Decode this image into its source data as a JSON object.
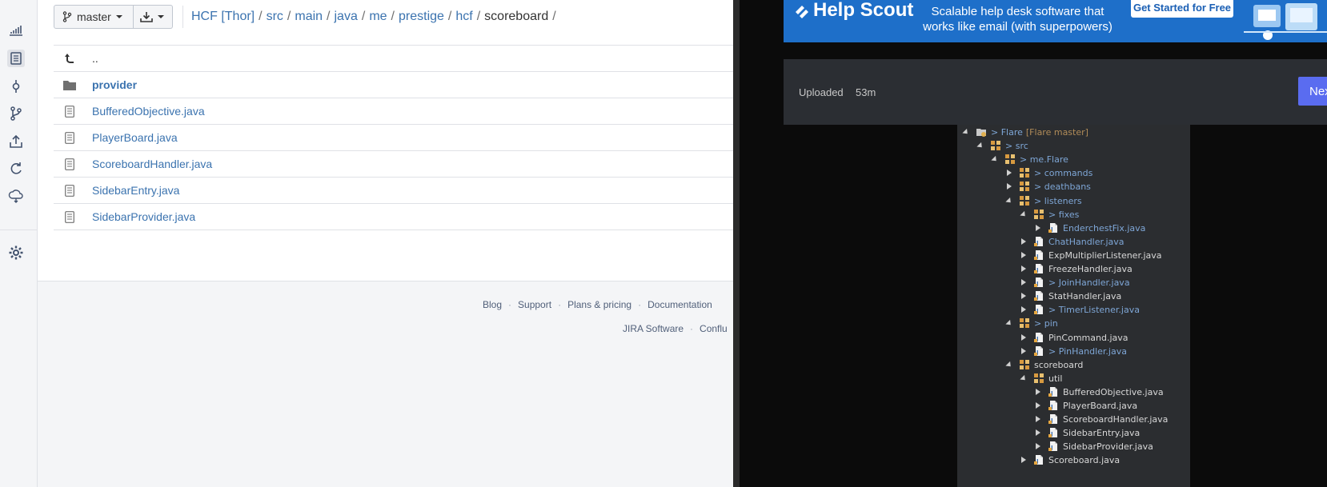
{
  "toolbar": {
    "branch_label": "master"
  },
  "breadcrumb": {
    "items": [
      "HCF [Thor]",
      "src",
      "main",
      "java",
      "me",
      "prestige",
      "hcf"
    ],
    "current": "scoreboard",
    "separator": "/"
  },
  "files": {
    "up": "..",
    "folder": "provider",
    "items": [
      "BufferedObjective.java",
      "PlayerBoard.java",
      "ScoreboardHandler.java",
      "SidebarEntry.java",
      "SidebarProvider.java"
    ]
  },
  "footer": {
    "row1": [
      "Blog",
      "Support",
      "Plans & pricing",
      "Documentation"
    ],
    "row2": [
      "JIRA Software",
      "Conflu"
    ]
  },
  "ad": {
    "brand": "Help Scout",
    "text_line1": "Scalable help desk software that",
    "text_line2": "works like email (with superpowers)",
    "cta": "Get Started for Free"
  },
  "post": {
    "uploaded_label": "Uploaded",
    "time": "53m",
    "next_label": "Next Post"
  },
  "tree": {
    "project_prefix": "> Flare",
    "project_annotation": "[Flare master]",
    "nodes": [
      {
        "label": "> src",
        "color": "blue",
        "twisty": "open",
        "icon": "src-folder-icon"
      },
      {
        "label": "> me.Flare",
        "color": "blue",
        "twisty": "open",
        "icon": "package-icon"
      },
      {
        "label": "> commands",
        "color": "blue",
        "twisty": "closed",
        "icon": "package-icon"
      },
      {
        "label": "> deathbans",
        "color": "blue",
        "twisty": "closed",
        "icon": "package-icon"
      },
      {
        "label": "> listeners",
        "color": "blue",
        "twisty": "open",
        "icon": "package-icon"
      },
      {
        "label": "> fixes",
        "color": "blue",
        "twisty": "open",
        "icon": "package-icon"
      },
      {
        "label": "EnderchestFix.java",
        "color": "blue",
        "twisty": "closed",
        "icon": "java-file-icon"
      },
      {
        "label": "ChatHandler.java",
        "color": "blue",
        "twisty": "closed",
        "icon": "java-file-icon"
      },
      {
        "label": "ExpMultiplierListener.java",
        "color": "white",
        "twisty": "closed",
        "icon": "java-file-icon"
      },
      {
        "label": "FreezeHandler.java",
        "color": "white",
        "twisty": "closed",
        "icon": "java-file-icon"
      },
      {
        "label": "> JoinHandler.java",
        "color": "blue",
        "twisty": "closed",
        "icon": "java-file-icon"
      },
      {
        "label": "StatHandler.java",
        "color": "white",
        "twisty": "closed",
        "icon": "java-file-icon"
      },
      {
        "label": "> TimerListener.java",
        "color": "blue",
        "twisty": "closed",
        "icon": "java-file-icon"
      },
      {
        "label": "> pin",
        "color": "blue",
        "twisty": "open",
        "icon": "package-icon"
      },
      {
        "label": "PinCommand.java",
        "color": "white",
        "twisty": "closed",
        "icon": "java-file-icon"
      },
      {
        "label": "> PinHandler.java",
        "color": "blue",
        "twisty": "closed",
        "icon": "java-file-icon"
      },
      {
        "label": "scoreboard",
        "color": "white",
        "twisty": "open",
        "icon": "package-icon"
      },
      {
        "label": "util",
        "color": "white",
        "twisty": "open",
        "icon": "package-icon"
      },
      {
        "label": "BufferedObjective.java",
        "color": "white",
        "twisty": "closed",
        "icon": "java-file-icon"
      },
      {
        "label": "PlayerBoard.java",
        "color": "white",
        "twisty": "closed",
        "icon": "java-file-icon"
      },
      {
        "label": "ScoreboardHandler.java",
        "color": "white",
        "twisty": "closed",
        "icon": "java-file-icon"
      },
      {
        "label": "SidebarEntry.java",
        "color": "white",
        "twisty": "closed",
        "icon": "java-file-icon"
      },
      {
        "label": "SidebarProvider.java",
        "color": "white",
        "twisty": "closed",
        "icon": "java-file-icon"
      },
      {
        "label": "Scoreboard.java",
        "color": "white",
        "twisty": "closed",
        "icon": "java-file-icon"
      }
    ]
  }
}
